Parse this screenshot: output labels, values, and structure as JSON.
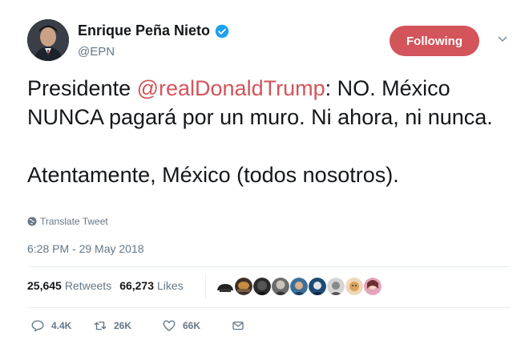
{
  "author": {
    "name": "Enrique Peña Nieto",
    "handle": "@EPN",
    "verified_icon": "verified-badge-icon"
  },
  "follow_button": {
    "label": "Following",
    "color": "#d3545a"
  },
  "tweet": {
    "prefix": "Presidente ",
    "mention": "@realDonaldTrump",
    "body": ": NO. México NUNCA pagará por un muro. Ni ahora, ni nunca.\n\nAtentamente, México (todos nosotros).",
    "mention_color": "#d3545a"
  },
  "translate_label": "Translate Tweet",
  "timestamp": "6:28 PM - 29 May 2018",
  "stats": {
    "retweets_count": "25,645",
    "retweets_label": "Retweets",
    "likes_count": "66,273",
    "likes_label": "Likes"
  },
  "actions": {
    "reply_count": "4.4K",
    "retweet_count": "26K",
    "like_count": "66K"
  },
  "icons": [
    "globe-icon",
    "chevron-down-icon",
    "reply-icon",
    "retweet-icon",
    "like-icon",
    "message-icon"
  ]
}
